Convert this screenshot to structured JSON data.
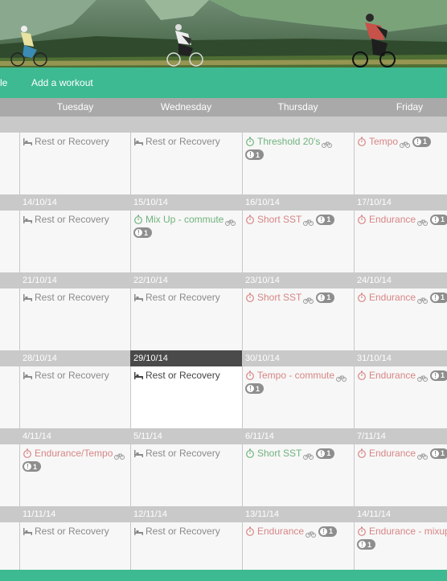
{
  "nav": {
    "profile_label": "file",
    "add_workout_label": "Add a workout"
  },
  "colors": {
    "accent": "#3dba91",
    "header_grey": "#a9a9a9",
    "today_bar": "#4a4a4a",
    "green_text": "#6fb37d",
    "red_text": "#d78585"
  },
  "days": [
    "Tuesday",
    "Wednesday",
    "Thursday",
    "Friday"
  ],
  "weeks": [
    {
      "dates": [
        "",
        "",
        "",
        ""
      ],
      "cells": [
        {
          "icon": "bed-icon",
          "label": "Rest or Recovery",
          "style": "rest"
        },
        {
          "icon": "bed-icon",
          "label": "Rest or Recovery",
          "style": "rest"
        },
        {
          "icon": "stopwatch-icon",
          "label": "Threshold 20's",
          "style": "green",
          "pill": "1",
          "pill_block": true
        },
        {
          "icon": "stopwatch-icon",
          "label": "Tempo",
          "style": "red",
          "pill": "1"
        }
      ]
    },
    {
      "dates": [
        "14/10/14",
        "15/10/14",
        "16/10/14",
        "17/10/14"
      ],
      "cells": [
        {
          "icon": "bed-icon",
          "label": "Rest or Recovery",
          "style": "rest"
        },
        {
          "icon": "stopwatch-icon",
          "label": "Mix Up - commute",
          "style": "green",
          "pill": "1",
          "pill_block": true
        },
        {
          "icon": "stopwatch-icon",
          "label": "Short SST",
          "style": "red",
          "pill": "1"
        },
        {
          "icon": "stopwatch-icon",
          "label": "Endurance",
          "style": "red",
          "pill": "1"
        }
      ]
    },
    {
      "dates": [
        "21/10/14",
        "22/10/14",
        "23/10/14",
        "24/10/14"
      ],
      "cells": [
        {
          "icon": "bed-icon",
          "label": "Rest or Recovery",
          "style": "rest"
        },
        {
          "icon": "bed-icon",
          "label": "Rest or Recovery",
          "style": "rest"
        },
        {
          "icon": "stopwatch-icon",
          "label": "Short SST",
          "style": "red",
          "pill": "1"
        },
        {
          "icon": "stopwatch-icon",
          "label": "Endurance",
          "style": "red",
          "pill": "1"
        }
      ]
    },
    {
      "dates": [
        "28/10/14",
        "29/10/14",
        "30/10/14",
        "31/10/14"
      ],
      "today_index": 1,
      "cells": [
        {
          "icon": "bed-icon",
          "label": "Rest or Recovery",
          "style": "rest"
        },
        {
          "icon": "bed-icon",
          "label": "Rest or Recovery",
          "style": "rest"
        },
        {
          "icon": "stopwatch-icon",
          "label": "Tempo - commute",
          "style": "red",
          "pill": "1",
          "pill_block": true
        },
        {
          "icon": "stopwatch-icon",
          "label": "Endurance",
          "style": "red",
          "pill": "1"
        }
      ]
    },
    {
      "dates": [
        "4/11/14",
        "5/11/14",
        "6/11/14",
        "7/11/14"
      ],
      "cells": [
        {
          "icon": "stopwatch-icon",
          "label": "Endurance/Tempo",
          "style": "red",
          "pill": "1",
          "pill_block": true
        },
        {
          "icon": "bed-icon",
          "label": "Rest or Recovery",
          "style": "rest"
        },
        {
          "icon": "stopwatch-icon",
          "label": "Short SST",
          "style": "green",
          "pill": "1"
        },
        {
          "icon": "stopwatch-icon",
          "label": "Endurance",
          "style": "red",
          "pill": "1"
        }
      ]
    },
    {
      "dates": [
        "11/11/14",
        "12/11/14",
        "13/11/14",
        "14/11/14"
      ],
      "cells": [
        {
          "icon": "bed-icon",
          "label": "Rest or Recovery",
          "style": "rest"
        },
        {
          "icon": "bed-icon",
          "label": "Rest or Recovery",
          "style": "rest"
        },
        {
          "icon": "stopwatch-icon",
          "label": "Endurance",
          "style": "red",
          "pill": "1"
        },
        {
          "icon": "stopwatch-icon",
          "label": "Endurance - mixup",
          "style": "red",
          "pill": "1",
          "pill_block": true
        }
      ]
    }
  ]
}
